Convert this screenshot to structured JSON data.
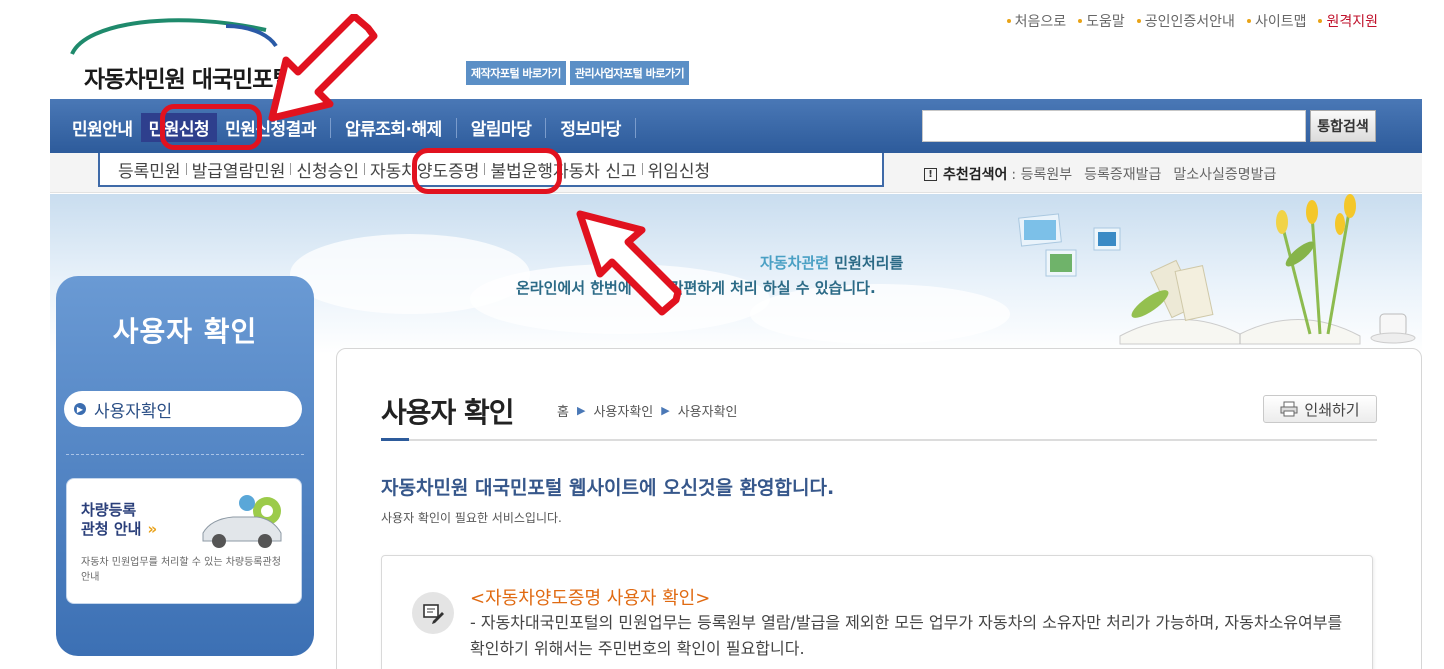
{
  "header": {
    "logo_text": "자동차민원 대국민포털",
    "portal_buttons": [
      "제작자포털 바로가기",
      "관리사업자포털 바로가기"
    ],
    "util_links": [
      "처음으로",
      "도움말",
      "공인인증서안내",
      "사이트맵",
      "원격지원"
    ]
  },
  "nav": {
    "items": [
      "민원안내",
      "민원신청",
      "민원신청결과",
      "압류조회·해제",
      "알림마당",
      "정보마당"
    ],
    "active_item": "민원신청",
    "search_value": "",
    "search_button": "통합검색"
  },
  "subnav": {
    "items": [
      "등록민원",
      "발급열람민원",
      "신청승인",
      "자동차양도증명",
      "불법운행자동차 신고",
      "위임신청"
    ],
    "highlighted_item": "자동차양도증명"
  },
  "recommended": {
    "label": "추천검색어",
    "terms": [
      ": 등록원부",
      "등록증재발급",
      "말소사실증명발급"
    ]
  },
  "banner": {
    "line1_highlight": "자동차관련",
    "line1_rest": " 민원처리를",
    "line2": "온라인에서 한번에 쉽고 간편하게 처리 하실 수 있습니다."
  },
  "sidebar": {
    "title": "사용자 확인",
    "items": [
      {
        "label": "사용자확인"
      }
    ],
    "promo": {
      "title_line1": "차량등록",
      "title_line2": "관청 안내",
      "arrow": "»",
      "description": "자동차 민원업무를 처리할 수 있는 차량등록관청 안내"
    }
  },
  "content": {
    "title": "사용자 확인",
    "breadcrumb": [
      "홈",
      "사용자확인",
      "사용자확인"
    ],
    "print_label": "인쇄하기",
    "welcome": "자동차민원 대국민포털 웹사이트에 오신것을 환영합니다.",
    "welcome_sub": "사용자 확인이 필요한 서비스입니다.",
    "notice_title": "<자동차양도증명 사용자 확인>",
    "notice_body": "- 자동차대국민포털의 민원업무는 등록원부 열람/발급을 제외한 모든 업무가 자동차의 소유자만 처리가 가능하며, 자동차소유여부를 확인하기 위해서는 주민번호의 확인이 필요합니다."
  },
  "colors": {
    "nav_blue": "#2d5b9b",
    "annotation_red": "#e1121f",
    "notice_orange": "#e06a12",
    "remote_red": "#c0112b"
  }
}
